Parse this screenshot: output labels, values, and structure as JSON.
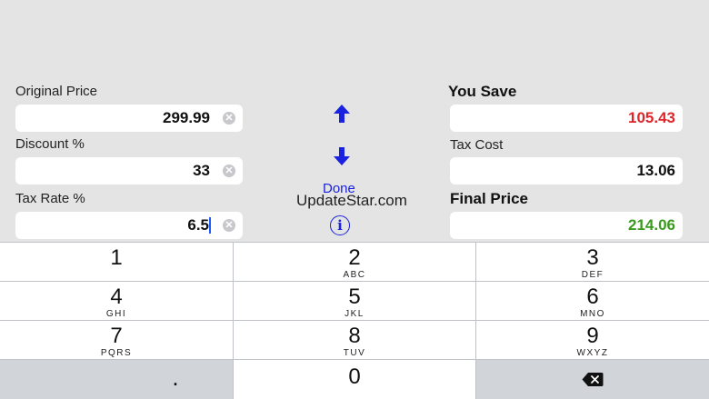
{
  "left": {
    "original_price": {
      "label": "Original Price",
      "value": "299.99"
    },
    "discount": {
      "label": "Discount %",
      "value": "33"
    },
    "tax_rate": {
      "label": "Tax Rate %",
      "value": "6.5"
    }
  },
  "middle": {
    "up_icon": "arrow-up-icon",
    "down_icon": "arrow-down-icon",
    "done_label": "Done",
    "watermark": "UpdateStar.com",
    "info_glyph": "i"
  },
  "right": {
    "you_save": {
      "label": "You Save",
      "value": "105.43",
      "color": "#e0252a"
    },
    "tax_cost": {
      "label": "Tax Cost",
      "value": "13.06"
    },
    "final_price": {
      "label": "Final Price",
      "value": "214.06",
      "color": "#3a9a1e"
    }
  },
  "keypad": {
    "keys": [
      {
        "digit": "1",
        "letters": ""
      },
      {
        "digit": "2",
        "letters": "ABC"
      },
      {
        "digit": "3",
        "letters": "DEF"
      },
      {
        "digit": "4",
        "letters": "GHI"
      },
      {
        "digit": "5",
        "letters": "JKL"
      },
      {
        "digit": "6",
        "letters": "MNO"
      },
      {
        "digit": "7",
        "letters": "PQRS"
      },
      {
        "digit": "8",
        "letters": "TUV"
      },
      {
        "digit": "9",
        "letters": "WXYZ"
      }
    ],
    "decimal": ".",
    "zero": "0",
    "delete_icon": "backspace-icon"
  }
}
